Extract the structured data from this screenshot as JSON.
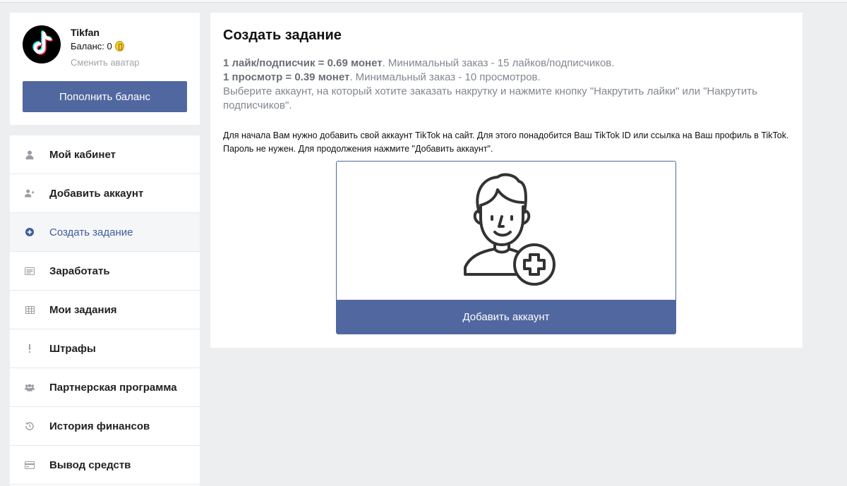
{
  "profile": {
    "username": "Tikfan",
    "balance_label": "Баланс: 0",
    "change_avatar": "Сменить аватар",
    "topup_button": "Пополнить баланс"
  },
  "menu": {
    "items": [
      {
        "label": "Мой кабинет",
        "icon": "user-icon",
        "active": false
      },
      {
        "label": "Добавить аккаунт",
        "icon": "add-user-icon",
        "active": false
      },
      {
        "label": "Создать задание",
        "icon": "plus-circle-icon",
        "active": true
      },
      {
        "label": "Заработать",
        "icon": "card-list-icon",
        "active": false
      },
      {
        "label": "Мои задания",
        "icon": "table-icon",
        "active": false
      },
      {
        "label": "Штрафы",
        "icon": "exclamation-icon",
        "active": false
      },
      {
        "label": "Партнерская программа",
        "icon": "users-icon",
        "active": false
      },
      {
        "label": "История финансов",
        "icon": "history-icon",
        "active": false
      },
      {
        "label": "Вывод средств",
        "icon": "credit-card-icon",
        "active": false
      }
    ]
  },
  "main": {
    "title": "Создать задание",
    "line1_bold": "1 лайк/подписчик = 0.69 монет",
    "line1_rest": ". Минимальный заказ - 15 лайков/подписчиков.",
    "line2_bold": "1 просмотр = 0.39 монет",
    "line2_rest": ". Минимальный заказ - 10 просмотров.",
    "line3": "Выберите аккаунт, на который хотите заказать накрутку и нажмите кнопку \"Накрутить лайки\" или \"Накрутить подписчиков\".",
    "note": "Для начала Вам нужно добавить свой аккаунт TikTok на сайт. Для этого понадобится Ваш TikTok ID или ссылка на Ваш профиль в TikTok. Пароль не нужен. Для продолжения нажмите \"Добавить аккаунт\".",
    "add_account_button": "Добавить аккаунт"
  },
  "colors": {
    "accent": "#5067a0",
    "active_text": "#3e5c9a",
    "background": "#edeef0"
  }
}
